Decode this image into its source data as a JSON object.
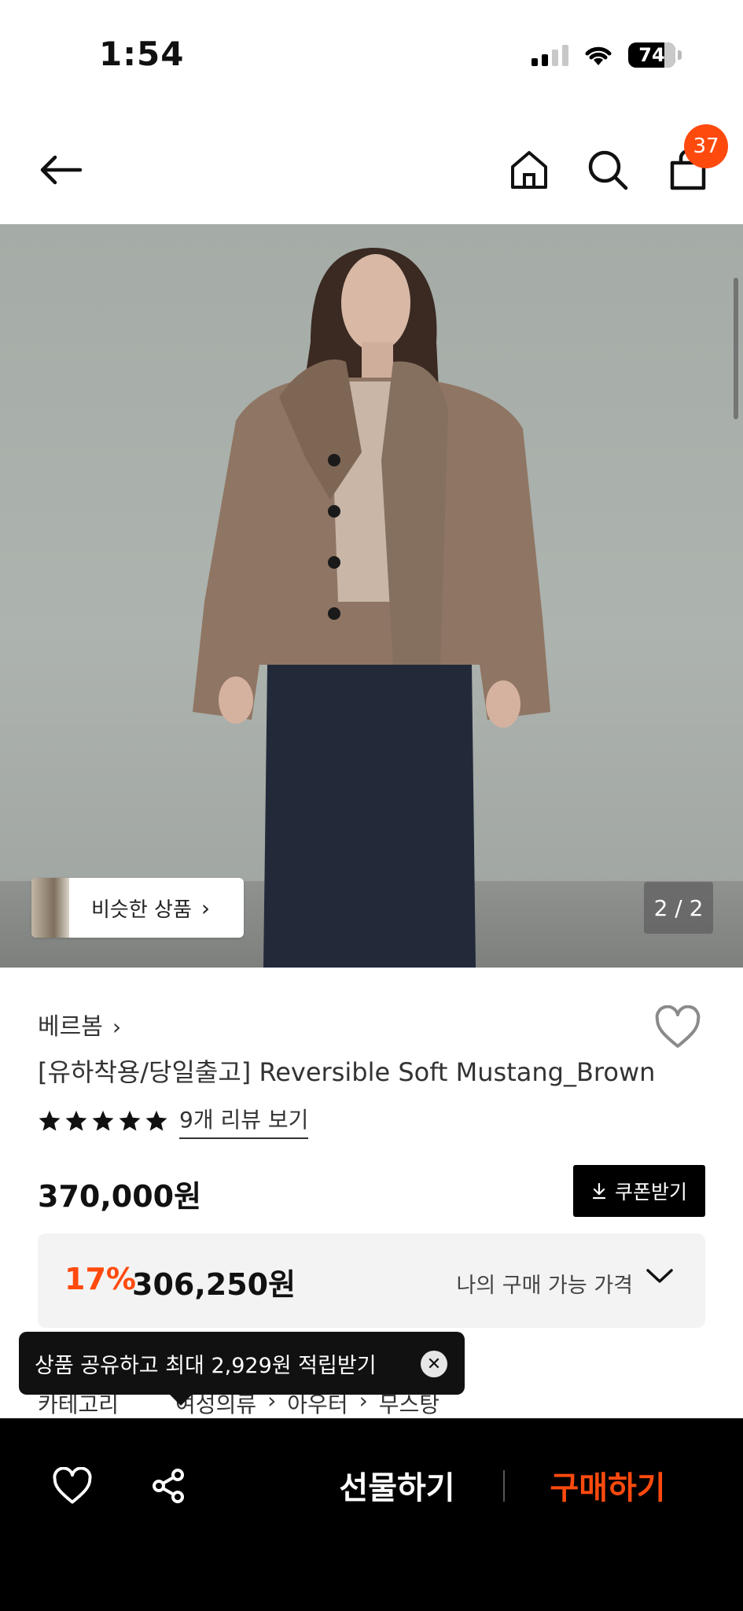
{
  "status_bar": {
    "time": "1:54",
    "battery": "74",
    "icons": [
      "cellular-signal-icon",
      "wifi-icon",
      "battery-icon"
    ]
  },
  "nav": {
    "icons": [
      "back-arrow-icon",
      "home-icon",
      "search-icon",
      "shopping-bag-icon"
    ],
    "cart_count": "37"
  },
  "gallery": {
    "similar_label": "비슷한 상품",
    "counter": "2 / 2"
  },
  "product": {
    "brand": "베르봄",
    "title": "[유하착용/당일출고] Reversible Soft Mustang_Brown",
    "rating_stars": 5,
    "review_link": "9개 리뷰 보기",
    "original_price": "370,000원",
    "coupon_label": "쿠폰받기",
    "discount_rate": "17%",
    "sale_price": "306,250원",
    "my_price_label": "나의 구매 가능 가격"
  },
  "tooltip": {
    "text": "상품 공유하고 최대 2,929원 적립받기"
  },
  "category": {
    "label": "카테고리",
    "path": [
      "여성의류",
      "아우터",
      "무스탕"
    ]
  },
  "bottom_bar": {
    "gift_label": "선물하기",
    "buy_label": "구매하기"
  },
  "colors": {
    "accent": "#ff4a0e",
    "dark": "#000000"
  }
}
